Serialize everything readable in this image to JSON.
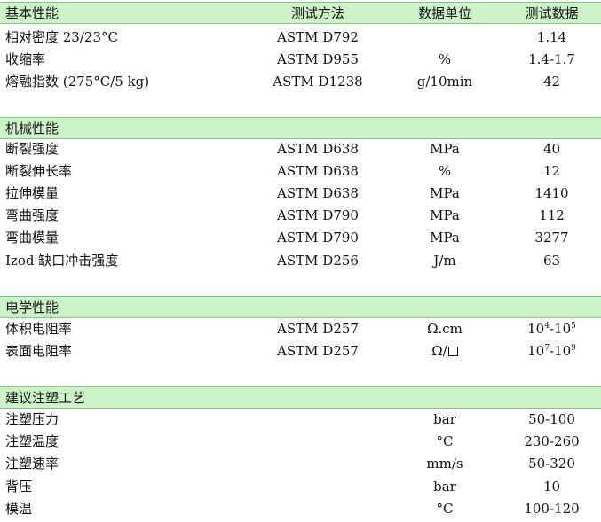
{
  "columns": {
    "property": "基本性能",
    "method": "测试方法",
    "unit": "数据单位",
    "value": "测试数据"
  },
  "sections": {
    "basic": {
      "rows": [
        {
          "property": "相对密度 23/23°C",
          "method": "ASTM D792",
          "unit": "",
          "value": "1.14"
        },
        {
          "property": "收缩率",
          "method": "ASTM D955",
          "unit": "%",
          "value": "1.4-1.7"
        },
        {
          "property": "熔融指数 (275°C/5 kg)",
          "method": "ASTM D1238",
          "unit": "g/10min",
          "value": "42"
        }
      ]
    },
    "mechanical": {
      "title": "机械性能",
      "rows": [
        {
          "property": "断裂强度",
          "method": "ASTM D638",
          "unit": "MPa",
          "value": "40"
        },
        {
          "property": "断裂伸长率",
          "method": "ASTM D638",
          "unit": "%",
          "value": "12"
        },
        {
          "property": "拉伸模量",
          "method": "ASTM D638",
          "unit": "MPa",
          "value": "1410"
        },
        {
          "property": "弯曲强度",
          "method": "ASTM D790",
          "unit": "MPa",
          "value": "112"
        },
        {
          "property": "弯曲模量",
          "method": "ASTM D790",
          "unit": "MPa",
          "value": "3277"
        },
        {
          "property": "Izod 缺口冲击强度",
          "method": "ASTM D256",
          "unit": "J/m",
          "value": "63"
        }
      ]
    },
    "electrical": {
      "title": "电学性能",
      "rows": [
        {
          "property": "体积电阻率",
          "method": "ASTM D257",
          "unit": "Ω.cm",
          "v1": "10",
          "e1": "4",
          "sep": "-",
          "v2": "10",
          "e2": "5"
        },
        {
          "property": "表面电阻率",
          "method": "ASTM D257",
          "unit": "Ω/",
          "v1": "10",
          "e1": "7",
          "sep": "-",
          "v2": "10",
          "e2": "9"
        }
      ]
    },
    "molding": {
      "title": "建议注塑工艺",
      "rows": [
        {
          "property": "注塑压力",
          "method": "",
          "unit": "bar",
          "value": "50-100"
        },
        {
          "property": "注塑温度",
          "method": "",
          "unit": "°C",
          "value": "230-260"
        },
        {
          "property": "注塑速率",
          "method": "",
          "unit": "mm/s",
          "value": "50-320"
        },
        {
          "property": "背压",
          "method": "",
          "unit": "bar",
          "value": "10"
        },
        {
          "property": "模温",
          "method": "",
          "unit": "°C",
          "value": "100-120"
        }
      ]
    }
  }
}
